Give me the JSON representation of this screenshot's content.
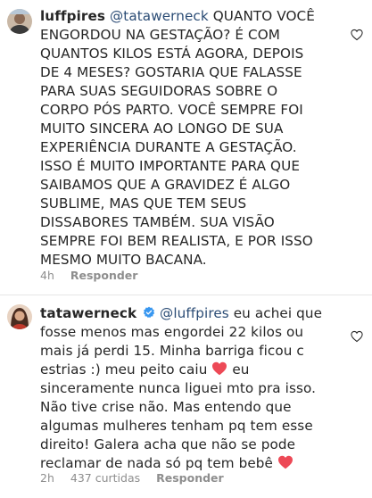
{
  "comments": [
    {
      "username": "luffpires",
      "mention": "@tatawerneck",
      "lines": [
        "QUANTO VOCÊ",
        "ENGORDOU NA GESTAÇÃO? É COM",
        "QUANTOS KILOS ESTÁ AGORA, DEPOIS",
        "DE 4 MESES? GOSTARIA QUE FALASSE",
        "PARA SUAS SEGUIDORAS SOBRE O",
        "CORPO PÓS PARTO. VOCÊ SEMPRE FOI",
        "MUITO SINCERA AO LONGO DE SUA",
        "EXPERIÊNCIA DURANTE A GESTAÇÃO.",
        "ISSO É MUITO IMPORTANTE PARA QUE",
        "SAIBAMOS QUE A GRAVIDEZ É ALGO",
        "SUBLIME, MAS QUE TEM SEUS",
        "DISSABORES TAMBÉM. SUA VISÃO",
        "SEMPRE FOI BEM REALISTA, E POR ISSO",
        "MESMO MUITO BACANA."
      ],
      "time": "4h",
      "reply_label": "Responder",
      "avatar_icon": "profile-photo"
    },
    {
      "username": "tatawerneck",
      "verified": true,
      "mention": "@luffpires",
      "first_line_rest": "eu achei que",
      "lines": [
        "fosse menos mas engordei 22 kilos ou",
        "mais já perdi 15. Minha barriga ficou c",
        "estrias :) meu peito caiu",
        "eu",
        "sinceramente nunca liguei mto pra isso.",
        "Não tive crise não. Mas entendo que",
        "algumas mulheres tenham pq tem esse",
        "direito! Galera acha que não se pode",
        "reclamar de nada só pq tem bebê"
      ],
      "time": "2h",
      "likes": "437 curtidas",
      "reply_label": "Responder",
      "avatar_icon": "profile-photo"
    }
  ],
  "colors": {
    "text": "#262626",
    "mention": "#2b4c75",
    "meta": "#8e8e8e",
    "verified": "#3897f0",
    "heart": "#ed4956"
  },
  "icons": [
    "heart-outline-icon",
    "verified-badge-icon",
    "red-heart-emoji"
  ]
}
